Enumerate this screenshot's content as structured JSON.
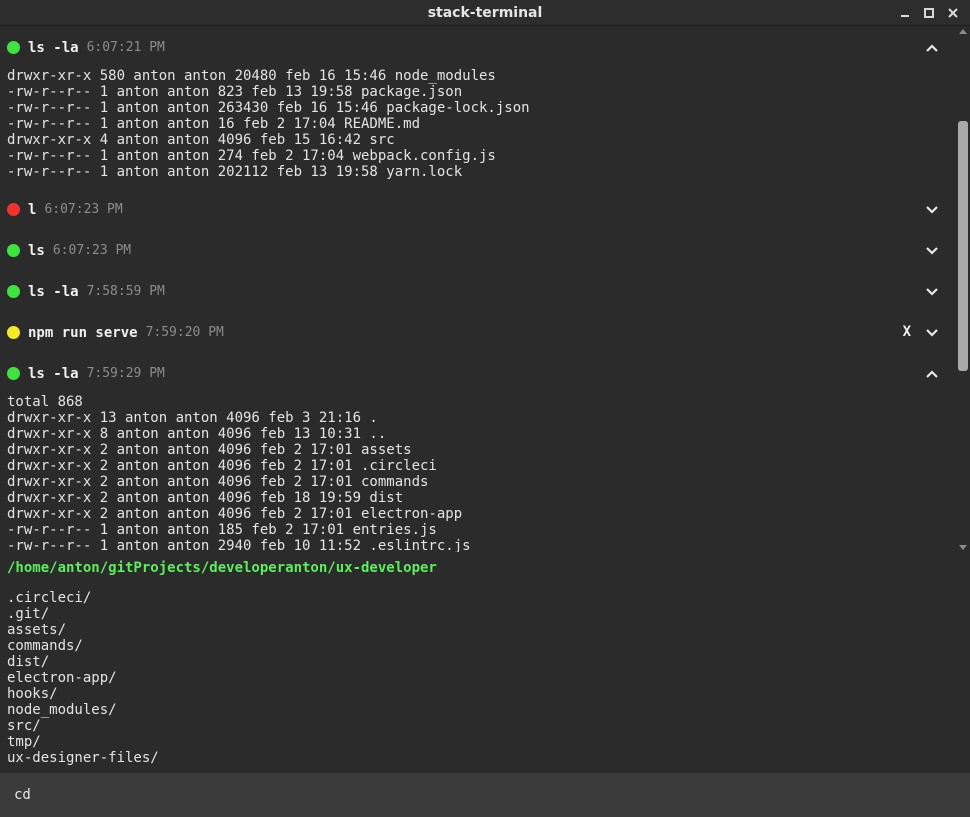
{
  "window": {
    "title": "stack-terminal",
    "minimize": "—",
    "maximize": "☐",
    "close": "✕"
  },
  "colors": {
    "success": "#3fe33f",
    "error": "#f0332d",
    "running": "#f4ea2a",
    "path": "#5bf05b"
  },
  "history": [
    {
      "command": "ls -la",
      "time": "6:07:21 PM",
      "status": "success",
      "expanded": true,
      "output": [
        "drwxr-xr-x 580 anton anton 20480 feb 16 15:46 node_modules",
        "-rw-r--r-- 1 anton anton 823 feb 13 19:58 package.json",
        "-rw-r--r-- 1 anton anton 263430 feb 16 15:46 package-lock.json",
        "-rw-r--r-- 1 anton anton 16 feb 2 17:04 README.md",
        "drwxr-xr-x 4 anton anton 4096 feb 15 16:42 src",
        "-rw-r--r-- 1 anton anton 274 feb 2 17:04 webpack.config.js",
        "-rw-r--r-- 1 anton anton 202112 feb 13 19:58 yarn.lock"
      ]
    },
    {
      "command": "l",
      "time": "6:07:23 PM",
      "status": "error",
      "expanded": false
    },
    {
      "command": "ls",
      "time": "6:07:23 PM",
      "status": "success",
      "expanded": false
    },
    {
      "command": "ls -la",
      "time": "7:58:59 PM",
      "status": "success",
      "expanded": false
    },
    {
      "command": "npm run serve",
      "time": "7:59:20 PM",
      "status": "running",
      "expanded": false,
      "kill_label": "X"
    },
    {
      "command": "ls -la",
      "time": "7:59:29 PM",
      "status": "success",
      "expanded": true,
      "output": [
        "total 868",
        "drwxr-xr-x 13 anton anton 4096 feb 3 21:16 .",
        "drwxr-xr-x 8 anton anton 4096 feb 13 10:31 ..",
        "drwxr-xr-x 2 anton anton 4096 feb 2 17:01 assets",
        "drwxr-xr-x 2 anton anton 4096 feb 2 17:01 .circleci",
        "drwxr-xr-x 2 anton anton 4096 feb 2 17:01 commands",
        "drwxr-xr-x 2 anton anton 4096 feb 18 19:59 dist",
        "drwxr-xr-x 2 anton anton 4096 feb 2 17:01 electron-app",
        "-rw-r--r-- 1 anton anton 185 feb 2 17:01 entries.js",
        "-rw-r--r-- 1 anton anton 2940 feb 10 11:52 .eslintrc.js"
      ]
    }
  ],
  "cwd": "/home/anton/gitProjects/developeranton/ux-developer",
  "directory_listing": [
    ".circleci/",
    ".git/",
    "assets/",
    "commands/",
    "dist/",
    "electron-app/",
    "hooks/",
    "node_modules/",
    "src/",
    "tmp/",
    "ux-designer-files/"
  ],
  "input": {
    "value": "cd",
    "placeholder": ""
  }
}
